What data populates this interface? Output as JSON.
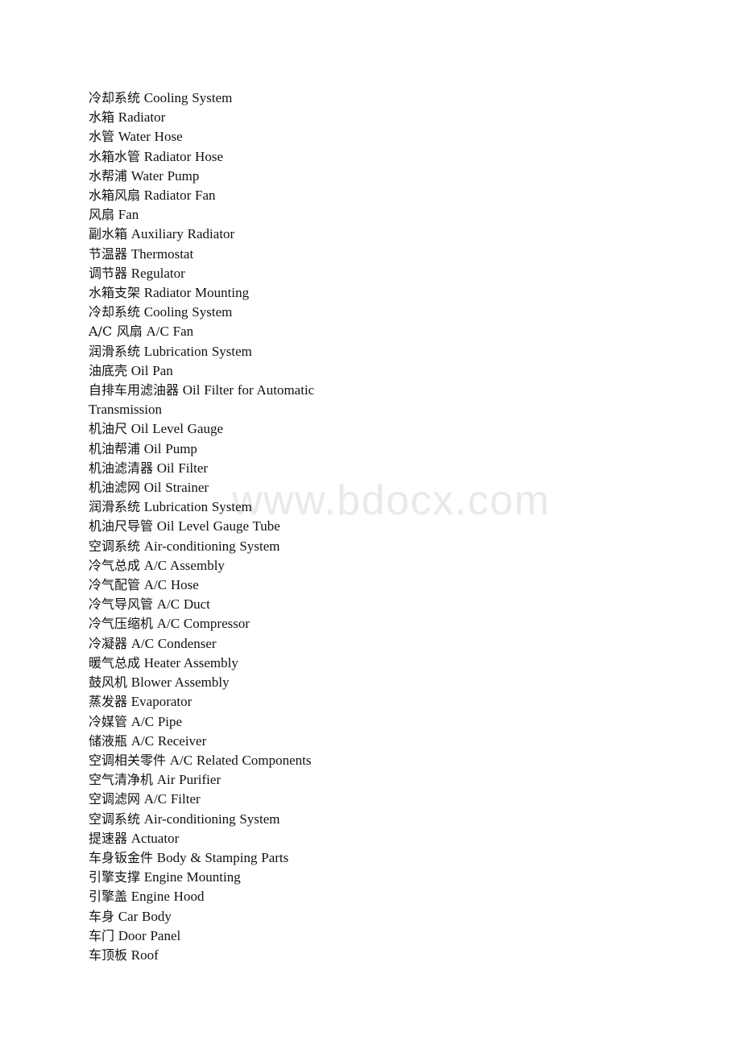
{
  "document": {
    "watermark": "www.bdocx.com",
    "watermark_color": "#e9e9e9",
    "text_color": "#111111",
    "background_color": "#ffffff",
    "glossary_title": "",
    "entries": [
      {
        "zh": "冷却系统",
        "en": "Cooling System"
      },
      {
        "zh": "水箱",
        "en": "Radiator"
      },
      {
        "zh": "水管",
        "en": "Water Hose"
      },
      {
        "zh": "水箱水管",
        "en": "Radiator Hose"
      },
      {
        "zh": "水帮浦",
        "en": "Water Pump"
      },
      {
        "zh": "水箱风扇",
        "en": "Radiator Fan"
      },
      {
        "zh": "风扇",
        "en": "Fan"
      },
      {
        "zh": "副水箱",
        "en": "Auxiliary Radiator"
      },
      {
        "zh": "节温器",
        "en": "Thermostat"
      },
      {
        "zh": "调节器",
        "en": "Regulator"
      },
      {
        "zh": "水箱支架",
        "en": "Radiator Mounting"
      },
      {
        "zh": "冷却系统",
        "en": "Cooling System"
      },
      {
        "zh": "A/C 风扇",
        "en": "A/C Fan"
      },
      {
        "zh": "润滑系统",
        "en": "Lubrication System"
      },
      {
        "zh": "油底壳",
        "en": "Oil Pan"
      },
      {
        "zh": "自排车用滤油器",
        "en": "Oil Filter for Automatic Transmission"
      },
      {
        "zh": "机油尺",
        "en": "Oil Level Gauge"
      },
      {
        "zh": "机油帮浦",
        "en": "Oil Pump"
      },
      {
        "zh": "机油滤清器",
        "en": "Oil Filter"
      },
      {
        "zh": "机油滤网",
        "en": "Oil Strainer"
      },
      {
        "zh": "润滑系统",
        "en": "Lubrication System"
      },
      {
        "zh": "机油尺导管",
        "en": "Oil Level Gauge Tube"
      },
      {
        "zh": "空调系统",
        "en": "Air-conditioning System"
      },
      {
        "zh": "冷气总成",
        "en": "A/C Assembly"
      },
      {
        "zh": "冷气配管",
        "en": "A/C Hose"
      },
      {
        "zh": "冷气导风管",
        "en": "A/C Duct"
      },
      {
        "zh": "冷气压缩机",
        "en": "A/C Compressor"
      },
      {
        "zh": "冷凝器",
        "en": "A/C Condenser"
      },
      {
        "zh": "暖气总成",
        "en": "Heater Assembly"
      },
      {
        "zh": "鼓风机",
        "en": "Blower Assembly"
      },
      {
        "zh": "蒸发器",
        "en": "Evaporator"
      },
      {
        "zh": "冷媒管",
        "en": "A/C Pipe"
      },
      {
        "zh": "储液瓶",
        "en": "A/C Receiver"
      },
      {
        "zh": "空调相关零件",
        "en": "A/C Related Components"
      },
      {
        "zh": "空气清净机",
        "en": "Air Purifier"
      },
      {
        "zh": "空调滤网",
        "en": "A/C Filter"
      },
      {
        "zh": "空调系统",
        "en": "Air-conditioning System"
      },
      {
        "zh": "提速器",
        "en": "Actuator"
      },
      {
        "zh": "车身钣金件",
        "en": "Body & Stamping Parts"
      },
      {
        "zh": "引擎支撑",
        "en": "Engine Mounting"
      },
      {
        "zh": "引擎盖",
        "en": "Engine Hood"
      },
      {
        "zh": "车身",
        "en": "Car Body"
      },
      {
        "zh": "车门",
        "en": "Door Panel"
      },
      {
        "zh": "车顶板",
        "en": "Roof"
      }
    ]
  }
}
